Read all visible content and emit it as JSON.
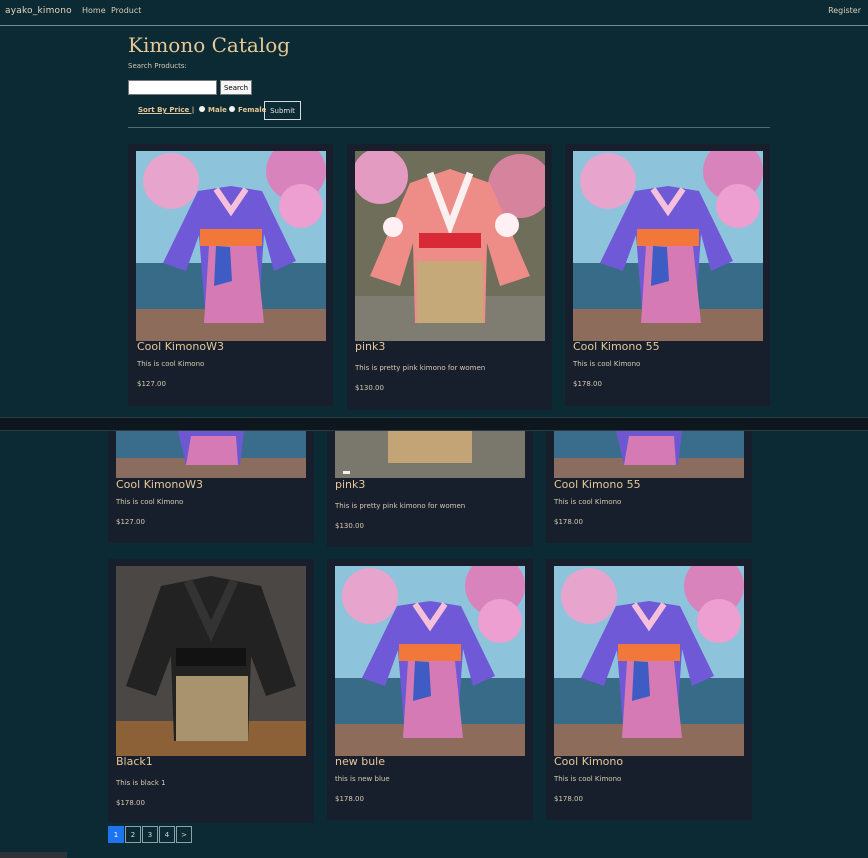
{
  "header": {
    "brand": "ayako_kimono",
    "nav": [
      "Home",
      "Product"
    ],
    "register": "Register"
  },
  "catalog": {
    "title": "Kimono Catalog",
    "search_label": "Search Products:",
    "search_value": "",
    "search_button": "Search",
    "sort_link": "Sort By Price |",
    "male": "Male",
    "female": "Female",
    "submit": "Submit"
  },
  "top_cards": [
    {
      "title": "Cool KimonoW3",
      "desc": "This is cool Kimono",
      "price": "$127.00"
    },
    {
      "title": "pink3",
      "desc": "This is pretty pink kimono for women",
      "price": "$130.00"
    },
    {
      "title": "Cool Kimono 55",
      "desc": "This is cool Kimono",
      "price": "$178.00"
    }
  ],
  "middle_cards": [
    {
      "title": "Cool KimonoW3",
      "desc": "This is cool Kimono",
      "price": "$127.00"
    },
    {
      "title": "pink3",
      "desc": "This is pretty pink kimono for women",
      "price": "$130.00"
    },
    {
      "title": "Cool Kimono 55",
      "desc": "This is cool Kimono",
      "price": "$178.00"
    }
  ],
  "bottom_cards": [
    {
      "title": "Black1",
      "desc": "This is black 1",
      "price": "$178.00"
    },
    {
      "title": "new bule",
      "desc": "this is new blue",
      "price": "$178.00"
    },
    {
      "title": "Cool Kimono",
      "desc": "This is cool Kimono",
      "price": "$178.00"
    }
  ],
  "pagination": {
    "pages": [
      "1",
      "2",
      "3",
      "4",
      ">"
    ],
    "active": "1"
  },
  "colors": {
    "background": "#0b2a33",
    "card": "#171f2d",
    "accent": "#e6c896",
    "active_page": "#1c74f0"
  }
}
